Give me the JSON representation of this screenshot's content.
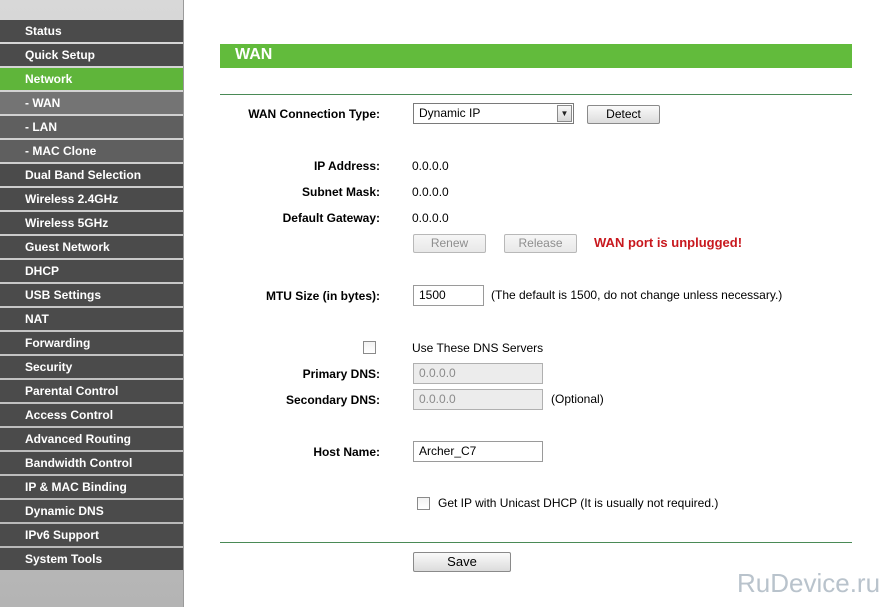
{
  "sidebar": {
    "items": [
      {
        "label": "Status"
      },
      {
        "label": "Quick Setup"
      },
      {
        "label": "Network"
      },
      {
        "label": "- WAN"
      },
      {
        "label": "- LAN"
      },
      {
        "label": "- MAC Clone"
      },
      {
        "label": "Dual Band Selection"
      },
      {
        "label": "Wireless 2.4GHz"
      },
      {
        "label": "Wireless 5GHz"
      },
      {
        "label": "Guest Network"
      },
      {
        "label": "DHCP"
      },
      {
        "label": "USB Settings"
      },
      {
        "label": "NAT"
      },
      {
        "label": "Forwarding"
      },
      {
        "label": "Security"
      },
      {
        "label": "Parental Control"
      },
      {
        "label": "Access Control"
      },
      {
        "label": "Advanced Routing"
      },
      {
        "label": "Bandwidth Control"
      },
      {
        "label": "IP & MAC Binding"
      },
      {
        "label": "Dynamic DNS"
      },
      {
        "label": "IPv6 Support"
      },
      {
        "label": "System Tools"
      }
    ]
  },
  "page": {
    "title": "WAN"
  },
  "form": {
    "wan_type_label": "WAN Connection Type:",
    "wan_type_value": "Dynamic IP",
    "detect_label": "Detect",
    "ip_label": "IP Address:",
    "ip_value": "0.0.0.0",
    "mask_label": "Subnet Mask:",
    "mask_value": "0.0.0.0",
    "gateway_label": "Default Gateway:",
    "gateway_value": "0.0.0.0",
    "renew_label": "Renew",
    "release_label": "Release",
    "status_msg": "WAN port is unplugged!",
    "mtu_label": "MTU Size (in bytes):",
    "mtu_value": "1500",
    "mtu_hint": "(The default is 1500, do not change unless necessary.)",
    "dns_toggle_label": "Use These DNS Servers",
    "primary_dns_label": "Primary DNS:",
    "primary_dns_value": "0.0.0.0",
    "secondary_dns_label": "Secondary DNS:",
    "secondary_dns_value": "0.0.0.0",
    "secondary_dns_hint": "(Optional)",
    "host_label": "Host Name:",
    "host_value": "Archer_C7",
    "unicast_label": "Get IP with Unicast DHCP (It is usually not required.)",
    "save_label": "Save"
  },
  "watermark": {
    "text": "RuDevice.ru"
  },
  "colors": {
    "accent": "#62bb3c",
    "menu": "#4b4b4b",
    "error": "#c8181e"
  }
}
